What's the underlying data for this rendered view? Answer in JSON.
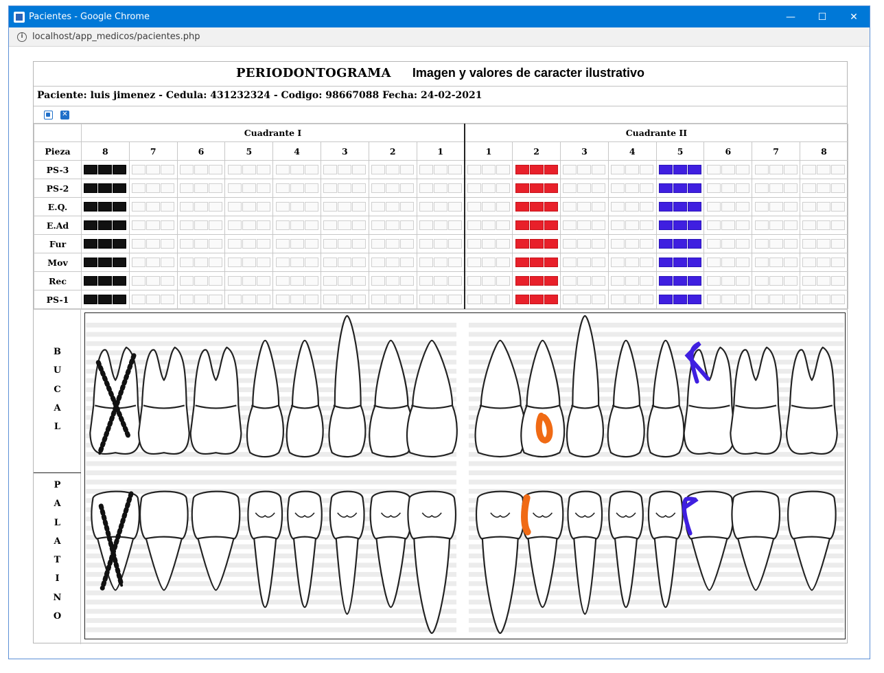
{
  "window": {
    "title": "Pacientes - Google Chrome",
    "minimize": "—",
    "maximize": "☐",
    "close": "✕"
  },
  "address": {
    "url": "localhost/app_medicos/pacientes.php"
  },
  "page": {
    "title": "PERIODONTOGRAMA",
    "subtitle": "Imagen y valores de caracter ilustrativo",
    "patient": "Paciente: luis jimenez - Cedula: 431232324 - Codigo: 98667088 Fecha: 24-02-2021",
    "quadrant1": "Cuadrante I",
    "quadrant2": "Cuadrante II",
    "pieza_label": "Pieza",
    "q1_teeth": [
      "8",
      "7",
      "6",
      "5",
      "4",
      "3",
      "2",
      "1"
    ],
    "q2_teeth": [
      "1",
      "2",
      "3",
      "4",
      "5",
      "6",
      "7",
      "8"
    ],
    "rows": [
      "PS-3",
      "PS-2",
      "E.Q.",
      "E.Ad",
      "Fur",
      "Mov",
      "Rec",
      "PS-1"
    ],
    "marked": {
      "q1_tooth_8": "#111111",
      "q2_tooth_2": "#e8202a",
      "q2_tooth_5": "#3f1fe0"
    },
    "bucal_letters": [
      "B",
      "U",
      "C",
      "A",
      "L"
    ],
    "palatino_letters": [
      "P",
      "A",
      "L",
      "A",
      "T",
      "I",
      "N",
      "O"
    ]
  },
  "colors": {
    "titlebar": "#0078d7",
    "red": "#e8202a",
    "blue": "#3f1fe0",
    "orange": "#f06a14",
    "black": "#111111"
  }
}
